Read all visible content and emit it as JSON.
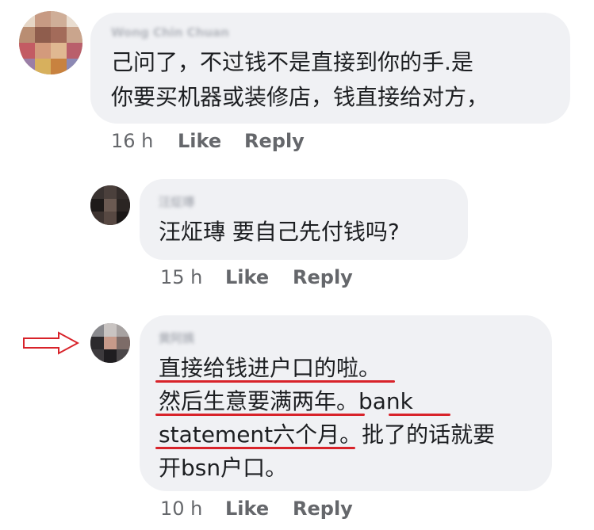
{
  "comments": [
    {
      "author": "Wong Chin Chuan",
      "lines": [
        "己问了，不过钱不是直接到你的手.是",
        "你要买机器或装修店，钱直接给对方，"
      ],
      "time": "16 h",
      "like": "Like",
      "reply": "Reply"
    },
    {
      "author": "汪炡瑼",
      "lines": [
        "汪炡瑼 要自己先付钱吗?"
      ],
      "time": "15 h",
      "like": "Like",
      "reply": "Reply"
    },
    {
      "author": "黄阿姨",
      "lines": [
        "直接给钱进户口的啦。",
        "然后生意要满两年。bank",
        "statement六个月。批了的话就要",
        "开bsn户口。"
      ],
      "time": "10 h",
      "like": "Like",
      "reply": "Reply"
    }
  ],
  "colors": {
    "bubble": "#f0f1f4",
    "text": "#1c1e21",
    "meta": "#65676b",
    "annotation": "#d8232a"
  },
  "icons": [
    "red-outline-arrow-icon"
  ]
}
